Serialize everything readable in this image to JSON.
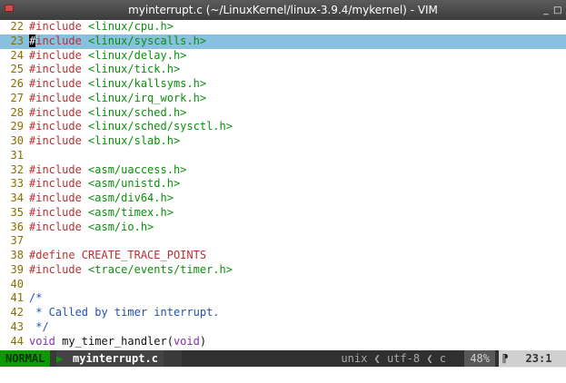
{
  "window": {
    "title": "myinterrupt.c (~/LinuxKernel/linux-3.9.4/mykernel) - VIM",
    "controls": [
      "_",
      "□"
    ]
  },
  "editor": {
    "lines": [
      {
        "num": "22",
        "parts": [
          [
            "inc",
            "#include"
          ],
          [
            "code",
            " <linux/cpu.h>"
          ]
        ]
      },
      {
        "num": "23",
        "current": true,
        "parts": [
          [
            "cursor",
            "#"
          ],
          [
            "inc",
            "include"
          ],
          [
            "code",
            " <linux/syscalls.h>"
          ]
        ]
      },
      {
        "num": "24",
        "parts": [
          [
            "inc",
            "#include"
          ],
          [
            "code",
            " <linux/delay.h>"
          ]
        ]
      },
      {
        "num": "25",
        "parts": [
          [
            "inc",
            "#include"
          ],
          [
            "code",
            " <linux/tick.h>"
          ]
        ]
      },
      {
        "num": "26",
        "parts": [
          [
            "inc",
            "#include"
          ],
          [
            "code",
            " <linux/kallsyms.h>"
          ]
        ]
      },
      {
        "num": "27",
        "parts": [
          [
            "inc",
            "#include"
          ],
          [
            "code",
            " <linux/irq_work.h>"
          ]
        ]
      },
      {
        "num": "28",
        "parts": [
          [
            "inc",
            "#include"
          ],
          [
            "code",
            " <linux/sched.h>"
          ]
        ]
      },
      {
        "num": "29",
        "parts": [
          [
            "inc",
            "#include"
          ],
          [
            "code",
            " <linux/sched/sysctl.h>"
          ]
        ]
      },
      {
        "num": "30",
        "parts": [
          [
            "inc",
            "#include"
          ],
          [
            "code",
            " <linux/slab.h>"
          ]
        ]
      },
      {
        "num": "31",
        "parts": []
      },
      {
        "num": "32",
        "parts": [
          [
            "inc",
            "#include"
          ],
          [
            "code",
            " <asm/uaccess.h>"
          ]
        ]
      },
      {
        "num": "33",
        "parts": [
          [
            "inc",
            "#include"
          ],
          [
            "code",
            " <asm/unistd.h>"
          ]
        ]
      },
      {
        "num": "34",
        "parts": [
          [
            "inc",
            "#include"
          ],
          [
            "code",
            " <asm/div64.h>"
          ]
        ]
      },
      {
        "num": "35",
        "parts": [
          [
            "inc",
            "#include"
          ],
          [
            "code",
            " <asm/timex.h>"
          ]
        ]
      },
      {
        "num": "36",
        "parts": [
          [
            "inc",
            "#include"
          ],
          [
            "code",
            " <asm/io.h>"
          ]
        ]
      },
      {
        "num": "37",
        "parts": []
      },
      {
        "num": "38",
        "parts": [
          [
            "inc",
            "#define"
          ],
          [
            "inc",
            " CREATE_TRACE_POINTS"
          ]
        ]
      },
      {
        "num": "39",
        "parts": [
          [
            "inc",
            "#include"
          ],
          [
            "code",
            " <trace/events/timer.h>"
          ]
        ]
      },
      {
        "num": "40",
        "parts": []
      },
      {
        "num": "41",
        "parts": [
          [
            "cmt",
            "/*"
          ]
        ]
      },
      {
        "num": "42",
        "parts": [
          [
            "cmt",
            " * Called by timer interrupt."
          ]
        ]
      },
      {
        "num": "43",
        "parts": [
          [
            "cmt",
            " */"
          ]
        ]
      },
      {
        "num": "44",
        "parts": [
          [
            "kw",
            "void"
          ],
          [
            "id",
            " my_timer_handler("
          ],
          [
            "kw",
            "void"
          ],
          [
            "id",
            ")"
          ]
        ]
      }
    ]
  },
  "statusbar": {
    "mode": "NORMAL",
    "separator": "▶",
    "filename": "myinterrupt.c",
    "filename_sep": "▷",
    "fileinfo": "unix ❮ utf-8 ❮ c",
    "percent": "48%",
    "percent_sep": "◀",
    "pos_icon": "⁋",
    "position": "23:1"
  },
  "colors": {
    "mode_bg": "#0d9900",
    "current_line": "#88c0e0",
    "include": "#b43232",
    "string": "#0b8f0b",
    "comment": "#2050b8",
    "keyword": "#8b2bb5",
    "line_number": "#8a6d00"
  }
}
